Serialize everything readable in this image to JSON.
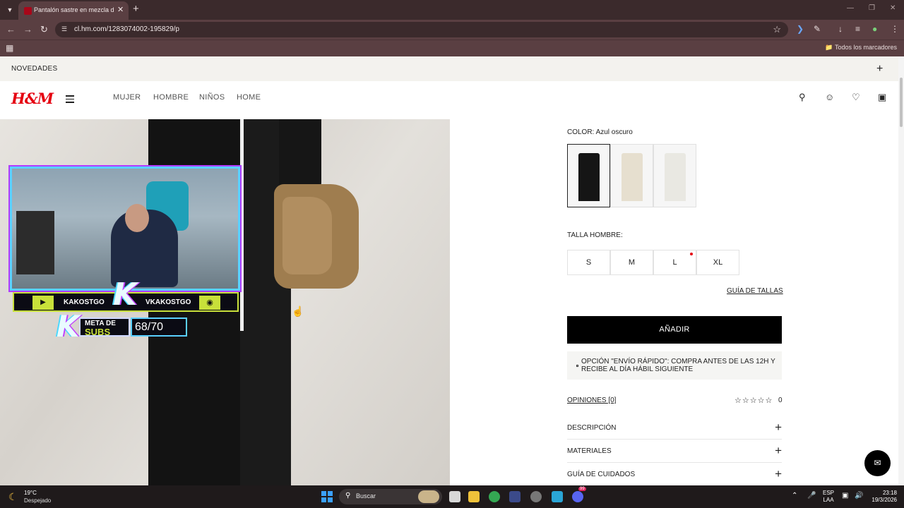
{
  "browser": {
    "tab_title": "Pantalón sastre en mezcla de lin",
    "url": "cl.hm.com/1283074002-195829/p",
    "all_bookmarks": "Todos los marcadores"
  },
  "promo": {
    "text": "NOVEDADES"
  },
  "header": {
    "logo": "H&M",
    "nav": [
      "MUJER",
      "HOMBRE",
      "NIÑOS",
      "HOME"
    ]
  },
  "overlay": {
    "name_left": "KAKOSTGO",
    "name_right": "VKAKOSTGO",
    "logo_letter": "K",
    "goal_line1": "META DE",
    "goal_line2": "SUBS",
    "goal_count": "68/70"
  },
  "product": {
    "color_label": "COLOR: Azul oscuro",
    "swatch_colors": [
      "#151515",
      "#e6dfcf",
      "#e9e8e2"
    ],
    "size_label": "TALLA HOMBRE:",
    "sizes": [
      "S",
      "M",
      "L",
      "XL"
    ],
    "size_guide": "GUÍA DE TALLAS",
    "add_button": "AÑADIR",
    "shipping_note": "OPCIÓN \"ENVÍO RÁPIDO\": COMPRA ANTES DE LAS 12H Y RECIBE AL DÍA HÁBIL SIGUIENTE",
    "reviews_link": "OPINIONES [0]",
    "rating": "0",
    "accordion": [
      "DESCRIPCIÓN",
      "MATERIALES",
      "GUÍA DE CUIDADOS"
    ]
  },
  "taskbar": {
    "temp": "19°C",
    "weather": "Despejado",
    "search": "Buscar",
    "lang1": "ESP",
    "lang2": "LAA",
    "time": "23:18",
    "date": "19/3/2026",
    "discord_badge": "99"
  },
  "colors": {
    "brand_red": "#e50010",
    "chrome_dark": "#3b2a2c",
    "chrome_mid": "#5a3f42"
  }
}
